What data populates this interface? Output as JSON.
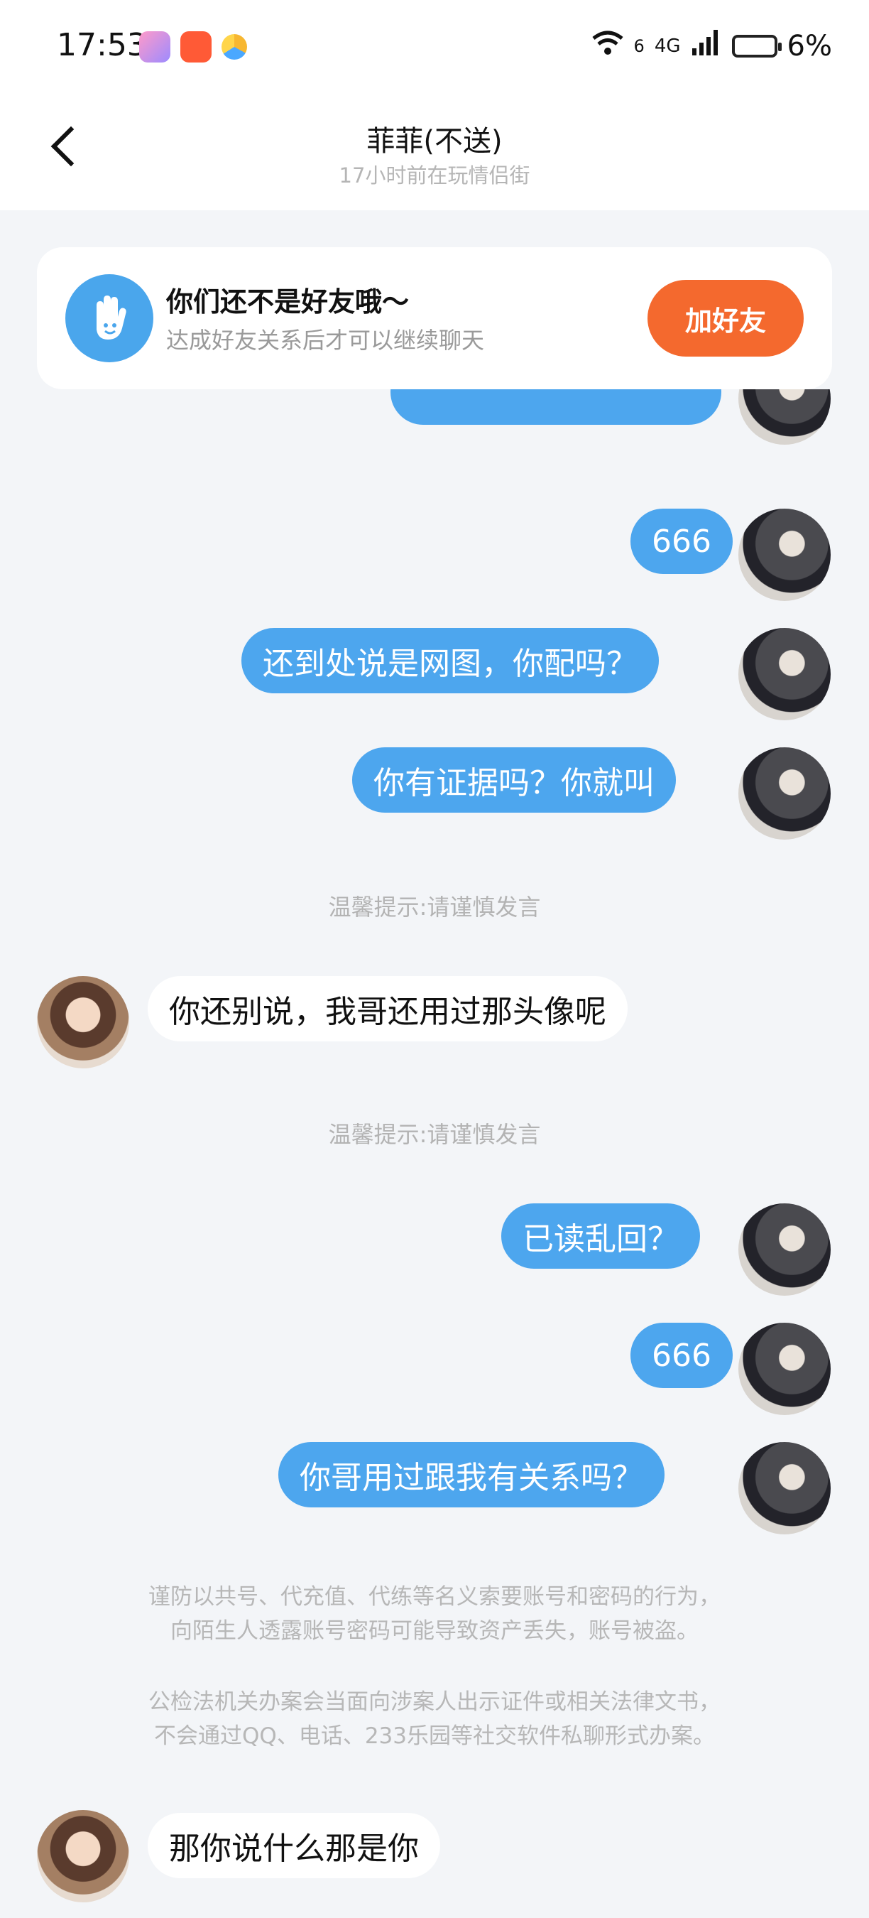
{
  "status_bar": {
    "time": "17:53",
    "signal": "6",
    "network": "4G",
    "battery": "6%"
  },
  "header": {
    "title": "菲菲(不送)",
    "subtitle": "17小时前在玩情侣街"
  },
  "friend_card": {
    "title": "你们还不是好友哦～",
    "subtitle": "达成好友关系后才可以继续聊天",
    "button": "加好友"
  },
  "messages": {
    "m1": "666",
    "m2": "还到处说是网图，你配吗？",
    "m3": "你有证据吗？你就叫",
    "m4": "你还别说，我哥还用过那头像呢",
    "m5": "已读乱回？",
    "m6": "666",
    "m7": "你哥用过跟我有关系吗？",
    "m8": "那你说什么那是你"
  },
  "hints": {
    "h1": "温馨提示:请谨慎发言",
    "h2": "温馨提示:请谨慎发言"
  },
  "notices": {
    "n1a": "谨防以共号、代充值、代练等名义索要账号和密码的行为，",
    "n1b": "向陌生人透露账号密码可能导致资产丢失，账号被盗。",
    "n2a": "公检法机关办案会当面向涉案人出示证件或相关法律文书，",
    "n2b": "不会通过QQ、电话、233乐园等社交软件私聊形式办案。"
  }
}
